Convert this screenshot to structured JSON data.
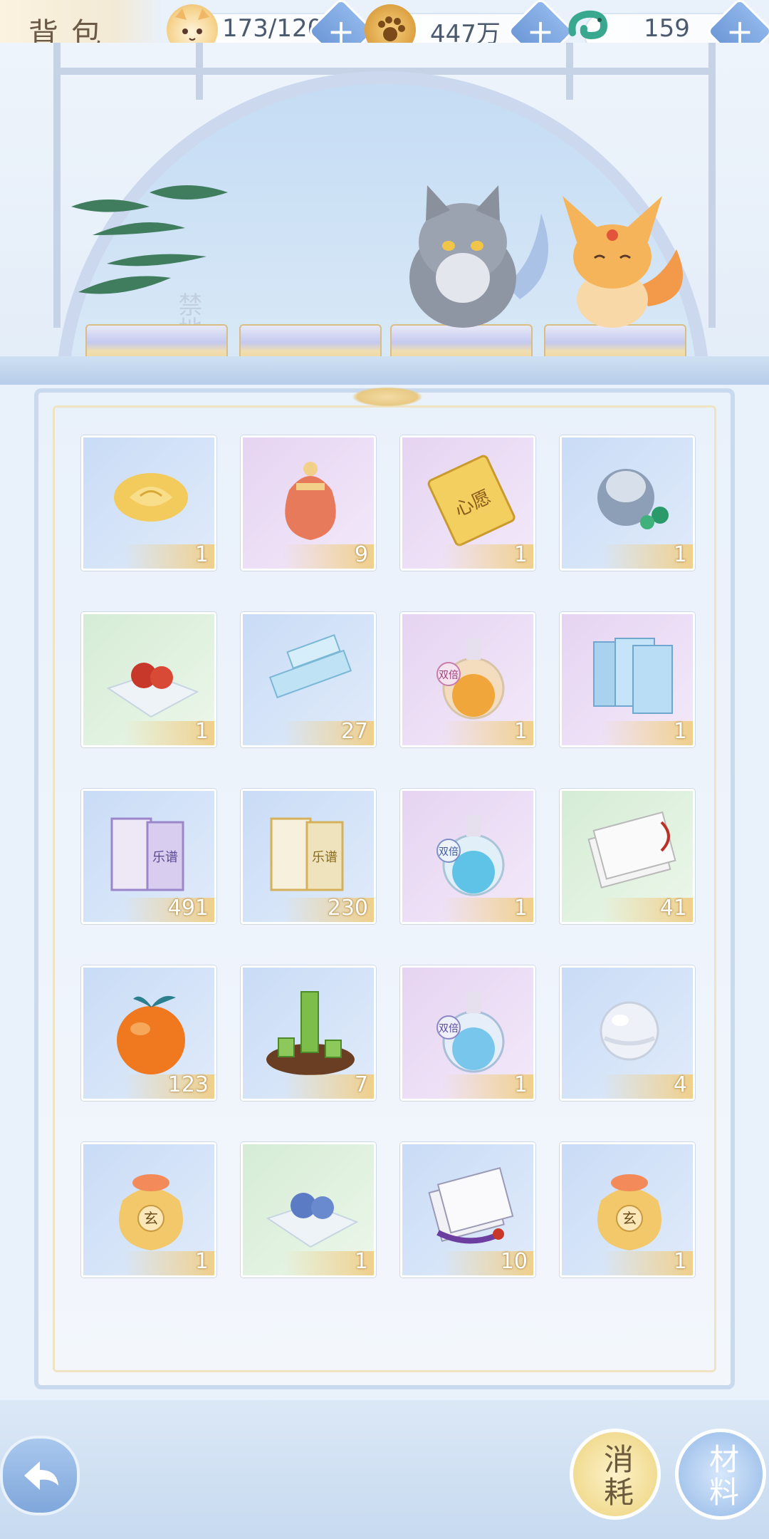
{
  "header": {
    "title": "背包"
  },
  "resources": [
    {
      "name": "stamina",
      "icon": "cat-face-icon",
      "value": "173/120"
    },
    {
      "name": "coins",
      "icon": "paw-coin-icon",
      "value": "447万"
    },
    {
      "name": "jade",
      "icon": "jade-dragon-icon",
      "value": "159"
    }
  ],
  "inventory": {
    "items": [
      {
        "icon": "yellow-rose-icon",
        "count": "1",
        "bg": "blue"
      },
      {
        "icon": "red-pouch-icon",
        "count": "9",
        "bg": "purple"
      },
      {
        "icon": "wish-ticket-icon",
        "count": "1",
        "bg": "purple",
        "label": "心愿"
      },
      {
        "icon": "blue-bag-icon",
        "count": "1",
        "bg": "blue"
      },
      {
        "icon": "red-berries-cloth-icon",
        "count": "1",
        "bg": "green"
      },
      {
        "icon": "scroll-icon",
        "count": "27",
        "bg": "blue"
      },
      {
        "icon": "orange-potion-icon",
        "count": "1",
        "bg": "purple",
        "label": "双倍"
      },
      {
        "icon": "blue-books-icon",
        "count": "1",
        "bg": "purple"
      },
      {
        "icon": "purple-music-book-icon",
        "count": "491",
        "bg": "blue",
        "label": "乐谱"
      },
      {
        "icon": "gold-music-book-icon",
        "count": "230",
        "bg": "blue",
        "label": "乐谱"
      },
      {
        "icon": "blue-potion-icon",
        "count": "1",
        "bg": "purple",
        "label": "双倍"
      },
      {
        "icon": "paper-stack-icon",
        "count": "41",
        "bg": "green"
      },
      {
        "icon": "orange-fruit-icon",
        "count": "123",
        "bg": "blue"
      },
      {
        "icon": "bamboo-tea-icon",
        "count": "7",
        "bg": "blue"
      },
      {
        "icon": "blue-potion-alt-icon",
        "count": "1",
        "bg": "purple",
        "label": "双倍"
      },
      {
        "icon": "pearl-icon",
        "count": "4",
        "bg": "blue"
      },
      {
        "icon": "xuan-pouch-icon",
        "count": "1",
        "bg": "blue",
        "label": "玄"
      },
      {
        "icon": "blue-berries-cloth-icon",
        "count": "1",
        "bg": "green"
      },
      {
        "icon": "purple-papers-icon",
        "count": "10",
        "bg": "blue"
      },
      {
        "icon": "xuan-pouch-icon",
        "count": "1",
        "bg": "blue",
        "label": "玄"
      }
    ]
  },
  "scene": {
    "wall_text": "禁地"
  },
  "bottom": {
    "consume_label": "消耗",
    "material_label": "材料"
  },
  "colors": {
    "accent_gold": "#efcf8b",
    "panel_border": "#c9daef"
  }
}
